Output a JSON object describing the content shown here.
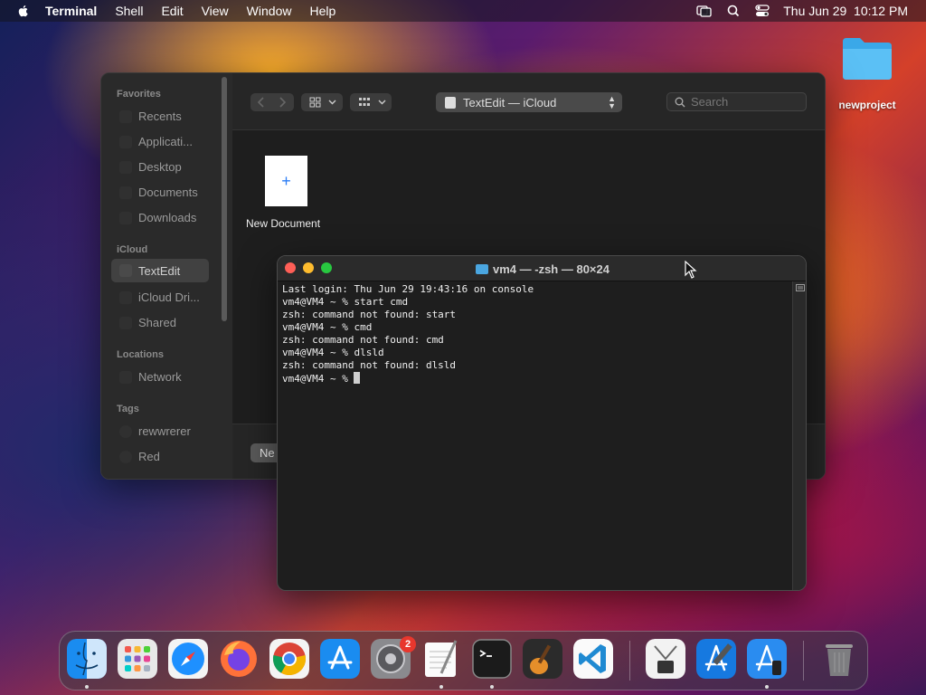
{
  "menubar": {
    "app_name": "Terminal",
    "items": [
      "Shell",
      "Edit",
      "View",
      "Window",
      "Help"
    ],
    "clock": "Thu Jun 29  10:12 PM"
  },
  "desktop": {
    "folder_label": "newproject"
  },
  "textedit_panel": {
    "sidebar": {
      "favorites_header": "Favorites",
      "favorites": [
        "Recents",
        "Applicati...",
        "Desktop",
        "Documents",
        "Downloads"
      ],
      "icloud_header": "iCloud",
      "icloud": [
        "TextEdit",
        "iCloud Dri...",
        "Shared"
      ],
      "locations_header": "Locations",
      "locations": [
        "Network"
      ],
      "tags_header": "Tags",
      "tags": [
        "rewwrerer",
        "Red"
      ]
    },
    "location_popup": "TextEdit — iCloud",
    "search_placeholder": "Search",
    "new_document_label": "New Document",
    "new_document_plus": "+",
    "new_button_label": "Ne"
  },
  "terminal": {
    "title": "vm4 — -zsh — 80×24",
    "lines": [
      "Last login: Thu Jun 29 19:43:16 on console",
      "vm4@VM4 ~ % start cmd",
      "zsh: command not found: start",
      "vm4@VM4 ~ % cmd",
      "zsh: command not found: cmd",
      "vm4@VM4 ~ % dlsld",
      "zsh: command not found: dlsld"
    ],
    "prompt": "vm4@VM4 ~ % "
  },
  "dock": {
    "settings_badge": "2",
    "apps": [
      "finder-icon",
      "launchpad-icon",
      "safari-icon",
      "firefox-icon",
      "chrome-icon",
      "app-store-icon",
      "system-settings-icon",
      "textedit-icon",
      "terminal-icon",
      "garageband-icon",
      "vscode-icon",
      "archive-utility-icon",
      "xcode-icon",
      "simulator-icon",
      "trash-icon"
    ]
  },
  "colors": {
    "close": "#ff5f57",
    "minimize": "#febc2e",
    "zoom": "#28c840",
    "accent": "#2a7cf5"
  }
}
